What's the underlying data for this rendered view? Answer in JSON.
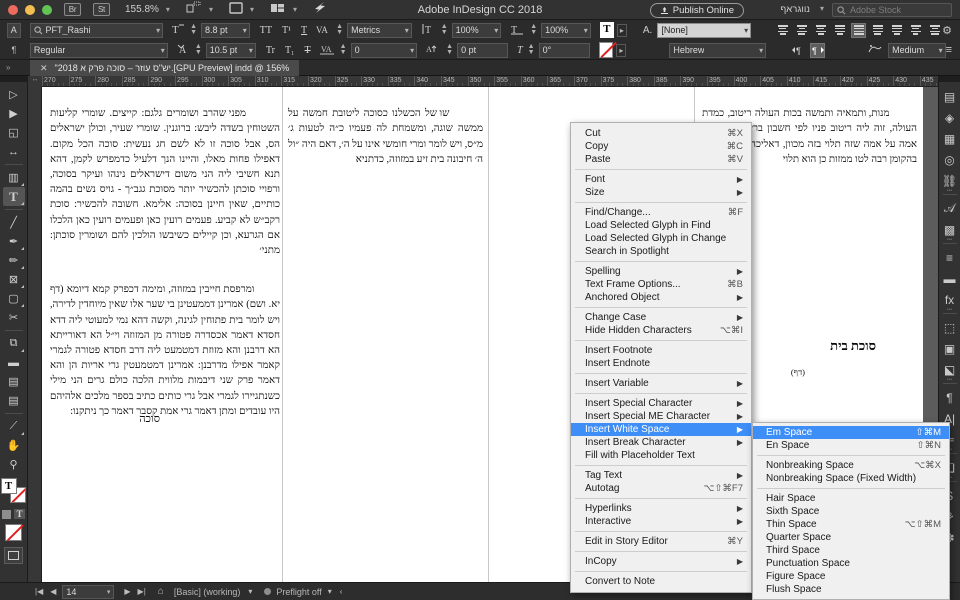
{
  "titlebar": {
    "app_title": "Adobe InDesign CC 2018",
    "bridge_label": "Br",
    "stock_label": "St",
    "zoom_level": "155.8%",
    "publish_online": "Publish Online",
    "workspace_name": "נווגראף",
    "stock_placeholder": "Adobe Stock"
  },
  "control_panel": {
    "char_mode_label": "A",
    "para_mode_label": "¶",
    "font_family": "PFT_Rashi",
    "font_style": "Regular",
    "font_size": "8.8 pt",
    "leading": "10.5 pt",
    "kerning": "Metrics",
    "tracking": "0",
    "vertical_scale": "100%",
    "horizontal_scale": "100%",
    "baseline_shift": "0 pt",
    "skew": "0°",
    "char_style": "[None]",
    "language": "Hebrew",
    "composer": "Medium",
    "all_caps": "TT",
    "small_caps": "Tr",
    "superscript": "T¹",
    "subscript": "T₁",
    "underline": "T",
    "strikethrough": "T"
  },
  "document_tab": {
    "title": "\"יש\"ס עוזר – סוכה פרק א 2018.[GPU Preview] indd @ 156%",
    "close_label": "✕"
  },
  "ruler": {
    "start": 270,
    "step": 5,
    "count": 34,
    "unit_corner": "↔"
  },
  "toolbar": {
    "tools": [
      {
        "name": "selection-tool",
        "glyph": "▷",
        "selected": false,
        "has_flyout": false
      },
      {
        "name": "direct-selection-tool",
        "glyph": "▶",
        "selected": false,
        "has_flyout": false
      },
      {
        "name": "page-tool",
        "glyph": "◱",
        "selected": false,
        "has_flyout": false
      },
      {
        "name": "gap-tool",
        "glyph": "↔",
        "selected": false,
        "has_flyout": false
      },
      {
        "name": "content-collector-tool",
        "glyph": "▥",
        "selected": false,
        "has_flyout": true
      },
      {
        "name": "type-tool",
        "glyph": "T",
        "selected": true,
        "has_flyout": true
      },
      {
        "name": "line-tool",
        "glyph": "╱",
        "selected": false,
        "has_flyout": false
      },
      {
        "name": "pen-tool",
        "glyph": "✒",
        "selected": false,
        "has_flyout": true
      },
      {
        "name": "pencil-tool",
        "glyph": "✏",
        "selected": false,
        "has_flyout": true
      },
      {
        "name": "frame-tool",
        "glyph": "⊠",
        "selected": false,
        "has_flyout": true
      },
      {
        "name": "rectangle-tool",
        "glyph": "▢",
        "selected": false,
        "has_flyout": true
      },
      {
        "name": "scissors-tool",
        "glyph": "✂",
        "selected": false,
        "has_flyout": false
      },
      {
        "name": "free-transform-tool",
        "glyph": "⧉",
        "selected": false,
        "has_flyout": true
      },
      {
        "name": "gradient-swatch-tool",
        "glyph": "▬",
        "selected": false,
        "has_flyout": false
      },
      {
        "name": "gradient-feather-tool",
        "glyph": "▤",
        "selected": false,
        "has_flyout": false
      },
      {
        "name": "note-tool",
        "glyph": "▤",
        "selected": false,
        "has_flyout": false
      },
      {
        "name": "eyedropper-tool",
        "glyph": "⟋",
        "selected": false,
        "has_flyout": true
      },
      {
        "name": "hand-tool",
        "glyph": "✋",
        "selected": false,
        "has_flyout": false
      },
      {
        "name": "zoom-tool",
        "glyph": "⚲",
        "selected": false,
        "has_flyout": false
      }
    ],
    "fill_label": "T",
    "apply_color_mode_label": "T"
  },
  "right_dock": {
    "icons": [
      "pages-icon",
      "layers-icon",
      "links-icon",
      "cc-libraries-icon",
      "links-chain-icon",
      "character-styles-icon",
      "object-styles-icon",
      "paragraph-icon",
      "gradient-icon",
      "effects-icon",
      "pathfinder-icon",
      "align-icon",
      "text-wrap-icon",
      "paragraph-mark-icon",
      "story-icon",
      "indent-icon",
      "layers-stack-icon",
      "swatches-icon",
      "color-theme-icon",
      "scripts-icon"
    ]
  },
  "context_menu": {
    "items": [
      {
        "label": "Cut",
        "shortcut": "⌘X",
        "submenu": false,
        "separator_after": false
      },
      {
        "label": "Copy",
        "shortcut": "⌘C",
        "submenu": false,
        "separator_after": false
      },
      {
        "label": "Paste",
        "shortcut": "⌘V",
        "submenu": false,
        "separator_after": true
      },
      {
        "label": "Font",
        "shortcut": "",
        "submenu": true,
        "separator_after": false
      },
      {
        "label": "Size",
        "shortcut": "",
        "submenu": true,
        "separator_after": true
      },
      {
        "label": "Find/Change...",
        "shortcut": "⌘F",
        "submenu": false,
        "separator_after": false
      },
      {
        "label": "Load Selected Glyph in Find",
        "shortcut": "",
        "submenu": false,
        "separator_after": false
      },
      {
        "label": "Load Selected Glyph in Change",
        "shortcut": "",
        "submenu": false,
        "separator_after": false
      },
      {
        "label": "Search in Spotlight",
        "shortcut": "",
        "submenu": false,
        "separator_after": true
      },
      {
        "label": "Spelling",
        "shortcut": "",
        "submenu": true,
        "separator_after": false
      },
      {
        "label": "Text Frame Options...",
        "shortcut": "⌘B",
        "submenu": false,
        "separator_after": false
      },
      {
        "label": "Anchored Object",
        "shortcut": "",
        "submenu": true,
        "separator_after": true
      },
      {
        "label": "Change Case",
        "shortcut": "",
        "submenu": true,
        "separator_after": false
      },
      {
        "label": "Hide Hidden Characters",
        "shortcut": "⌥⌘I",
        "submenu": false,
        "separator_after": true
      },
      {
        "label": "Insert Footnote",
        "shortcut": "",
        "submenu": false,
        "separator_after": false
      },
      {
        "label": "Insert Endnote",
        "shortcut": "",
        "submenu": false,
        "separator_after": true
      },
      {
        "label": "Insert Variable",
        "shortcut": "",
        "submenu": true,
        "separator_after": true
      },
      {
        "label": "Insert Special Character",
        "shortcut": "",
        "submenu": true,
        "separator_after": false
      },
      {
        "label": "Insert Special ME Character",
        "shortcut": "",
        "submenu": true,
        "separator_after": false
      },
      {
        "label": "Insert White Space",
        "shortcut": "",
        "submenu": true,
        "separator_after": false,
        "highlighted": true
      },
      {
        "label": "Insert Break Character",
        "shortcut": "",
        "submenu": true,
        "separator_after": false
      },
      {
        "label": "Fill with Placeholder Text",
        "shortcut": "",
        "submenu": false,
        "separator_after": true
      },
      {
        "label": "Tag Text",
        "shortcut": "",
        "submenu": true,
        "separator_after": false
      },
      {
        "label": "Autotag",
        "shortcut": "⌥⇧⌘F7",
        "submenu": false,
        "separator_after": true
      },
      {
        "label": "Hyperlinks",
        "shortcut": "",
        "submenu": true,
        "separator_after": false
      },
      {
        "label": "Interactive",
        "shortcut": "",
        "submenu": true,
        "separator_after": true
      },
      {
        "label": "Edit in Story Editor",
        "shortcut": "⌘Y",
        "submenu": false,
        "separator_after": true
      },
      {
        "label": "InCopy",
        "shortcut": "",
        "submenu": true,
        "separator_after": true
      },
      {
        "label": "Convert to Note",
        "shortcut": "",
        "submenu": false,
        "separator_after": false
      }
    ]
  },
  "submenu": {
    "items": [
      {
        "label": "Em Space",
        "shortcut": "⇧⌘M",
        "highlighted": true,
        "separator_after": false
      },
      {
        "label": "En Space",
        "shortcut": "⇧⌘N",
        "highlighted": false,
        "separator_after": true
      },
      {
        "label": "Nonbreaking Space",
        "shortcut": "⌥⌘X",
        "highlighted": false,
        "separator_after": false
      },
      {
        "label": "Nonbreaking Space (Fixed Width)",
        "shortcut": "",
        "highlighted": false,
        "separator_after": true
      },
      {
        "label": "Hair Space",
        "shortcut": "",
        "highlighted": false,
        "separator_after": false
      },
      {
        "label": "Sixth Space",
        "shortcut": "",
        "highlighted": false,
        "separator_after": false
      },
      {
        "label": "Thin Space",
        "shortcut": "⌥⇧⌘M",
        "highlighted": false,
        "separator_after": false
      },
      {
        "label": "Quarter Space",
        "shortcut": "",
        "highlighted": false,
        "separator_after": false
      },
      {
        "label": "Third Space",
        "shortcut": "",
        "highlighted": false,
        "separator_after": false
      },
      {
        "label": "Punctuation Space",
        "shortcut": "",
        "highlighted": false,
        "separator_after": false
      },
      {
        "label": "Figure Space",
        "shortcut": "",
        "highlighted": false,
        "separator_after": false
      },
      {
        "label": "Flush Space",
        "shortcut": "",
        "highlighted": false,
        "separator_after": false
      }
    ]
  },
  "status_bar": {
    "page_number": "14",
    "master_page": "[Basic] (working)",
    "preflight": "Preflight off",
    "first_label": "|◀",
    "prev_label": "◀",
    "next_label": "▶",
    "last_label": "▶|"
  },
  "document": {
    "col_left": "מפני שהרב ושומרים גלגם: קייצים. שומרי קליעות השטוחין בשדה ליבש: ברוגנין. שומרי שעיר, וכולן ישראלים הס, אבל סוכה זו לא לשם חג נעשית: סוכה הכל מקום. דאפילו פחות מאלו, והיינו הנך דלעיל כדמפרש לקמן, דהא תנא חשיבי ליה הני משום דישראלים נינהו ועיקר בסוכה, ורפויי סוכתן להכשיר יותר מסוכת גגב״ך - גויס נשים בהמה כותיים, שאין חיינן בסוכה: אלימא. חשובה להכשיר: סוכת רקב״ש לא קביע. פעמים רועין כאן ופעמים רועין כאן הלכלו אם הגרעא, וכן קיילים כשיבשו הולכין להם ושומרין סוכתן: מתני׳",
    "col_left_2": "ומרפסת חייבין במזוזה, ומימה דכפרק קמא דיומא (דף יא. ושם) אמרינן דממעטינן בי שער אלו שאין מיוחדין לדירה, ויש לומר בית פתוחין לגינה, וקשה דהא נמי למעוטי ליה דדא חסדא דאמר אכסדרה פטורה מן המזוזה וי״ל הא דאורייתא הא דרבנן והא מזוזת דמטמעט ליה דרב חסדא פטורה לגמרי קאמר אפילו מדרבנן: אמרינן דמטמעטין גרי אריות הן והא דאמר פרק שני דיבמות מלווית הלכה כולם גרים הני מילי כשנתגיירו לגמרי אבל גרי כותים כתיב בספר מלכים אלהיהם היו עובדים ומתן דאמר גרי אמת קסבר דאמר כך ניתקנו:",
    "col_left_heading": "סוכה",
    "col_mid": "שו של הכשלנו כסוכה ליטובת חמשה על ממשה שוגה, ומשמחת לה פעמיו כ״ה לטעות ג׳ מ״ס, ויש לומר ומרי חומשי אינו על ה׳, דאם היה ״ול ה׳ חיבונה בית זיע במזוזה, כדתניא",
    "col_right": "מנות, ותמאיה ותמשה בכות העולה ריטוב, כמדת העולה, זוה ליה ריטוב פניו לפי חשבון בריטוב פניו של אמה על אמה שזה תלוי בזה מכוון, דאליכה בו ה׳ על ה׳ בהקומן רבה לטו ממזות כן הוא תלוי",
    "col_right_heading": "סוכת בית",
    "col_right_daf": "(דף)"
  }
}
